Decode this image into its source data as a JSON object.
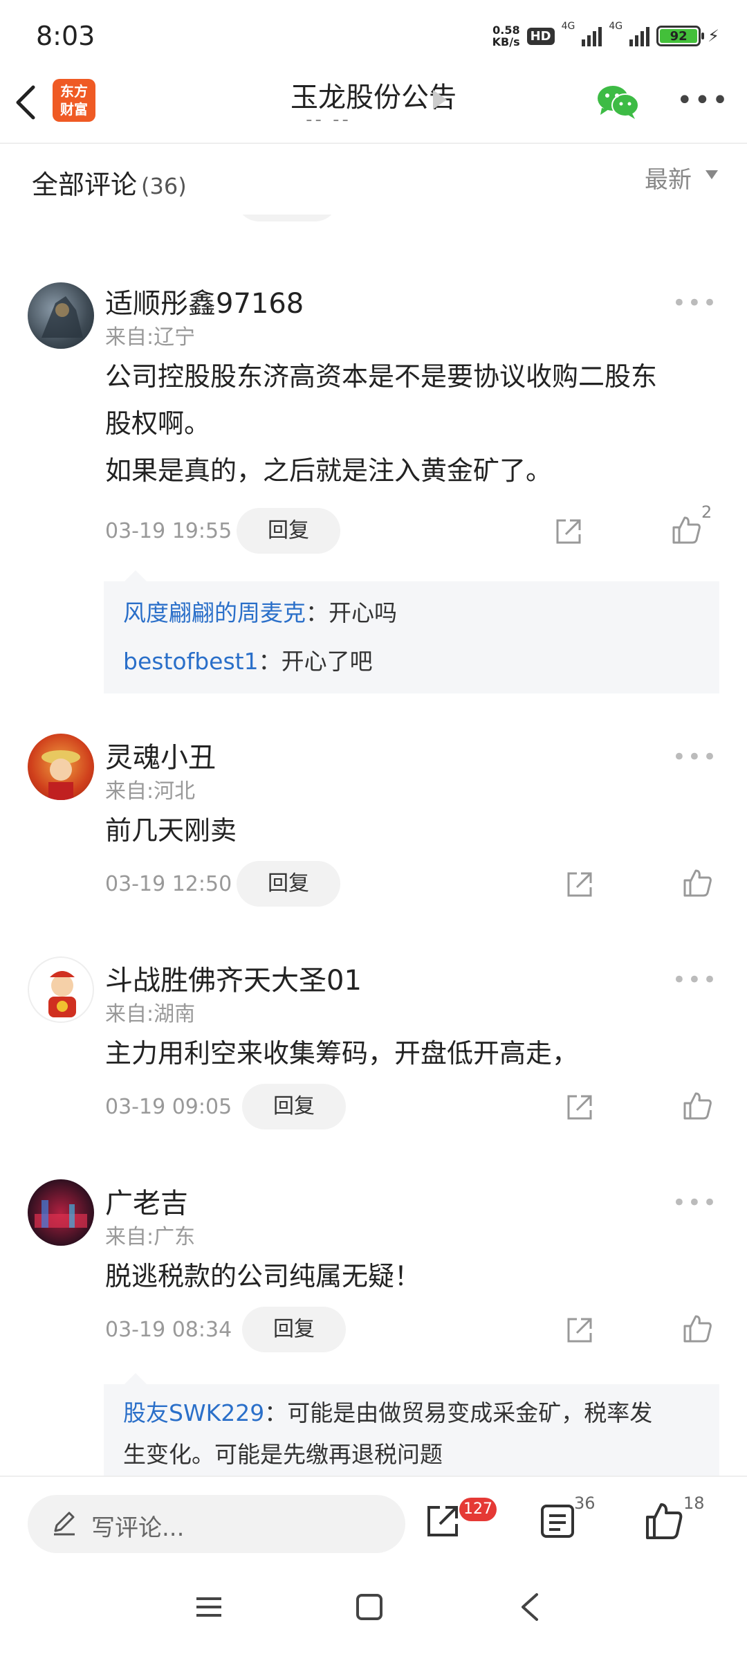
{
  "status_bar": {
    "time": "8:03",
    "net_speed_value": "0.58",
    "net_speed_unit": "KB/s",
    "hd_label": "HD",
    "net1": "4G",
    "net2": "4G",
    "battery": "92"
  },
  "header": {
    "back_icon": "chevron-left-icon",
    "logo_line1": "东方",
    "logo_line2": "财富",
    "title": "玉龙股份公告",
    "subtitle": "-- --",
    "share_icon": "wechat-icon",
    "more_icon": "more-icon"
  },
  "comments_header": {
    "title": "全部评论",
    "count": "(36)",
    "sort_label": "最新"
  },
  "comments": [
    {
      "username": "适顺彤鑫97168",
      "location": "来自:辽宁",
      "text_line1": "公司控股股东济高资本是不是要协议收购二股东",
      "text_line2": "股权啊。",
      "text_line3": "如果是真的，之后就是注入黄金矿了。",
      "date": "03-19 19:55",
      "reply_label": "回复",
      "likes": "2",
      "replies": [
        {
          "name": "风度翩翩的周麦克",
          "text": "：开心吗"
        },
        {
          "name": "bestofbest1",
          "text": "：开心了吧"
        }
      ]
    },
    {
      "username": "灵魂小丑",
      "location": "来自:河北",
      "text_line1": "前几天刚卖",
      "date": "03-19 12:50",
      "reply_label": "回复"
    },
    {
      "username": "斗战胜佛齐天大圣01",
      "location": "来自:湖南",
      "text_line1": "主力用利空来收集筹码，开盘低开高走，",
      "date": "03-19 09:05",
      "reply_label": "回复"
    },
    {
      "username": "广老吉",
      "location": "来自:广东",
      "text_line1": "脱逃税款的公司纯属无疑！",
      "date": "03-19 08:34",
      "reply_label": "回复",
      "replies": [
        {
          "name": "股友SWK229",
          "text": "：可能是由做贸易变成采金矿，税率发",
          "text2": "生变化。可能是先缴再退税问题"
        }
      ]
    }
  ],
  "bottom_bar": {
    "write_placeholder": "写评论...",
    "share_count": "127",
    "comment_count": "36",
    "like_count": "18"
  },
  "colors": {
    "accent_blue": "#2a6fc9",
    "logo_orange": "#ef5a24",
    "badge_red": "#e53935",
    "battery_green": "#43c03a",
    "wechat_green": "#3dbb45"
  }
}
